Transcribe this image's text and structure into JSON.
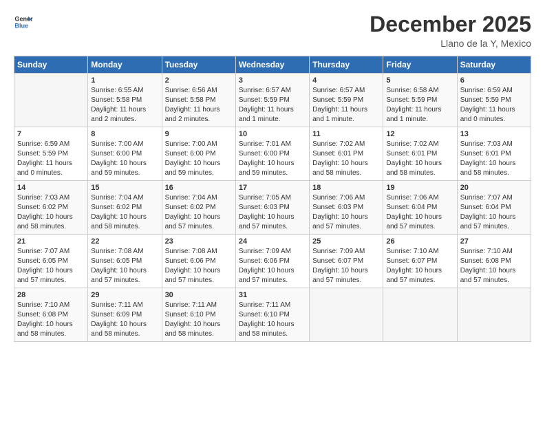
{
  "logo": {
    "line1": "General",
    "line2": "Blue"
  },
  "title": "December 2025",
  "location": "Llano de la Y, Mexico",
  "days_header": [
    "Sunday",
    "Monday",
    "Tuesday",
    "Wednesday",
    "Thursday",
    "Friday",
    "Saturday"
  ],
  "weeks": [
    [
      {
        "num": "",
        "info": ""
      },
      {
        "num": "1",
        "info": "Sunrise: 6:55 AM\nSunset: 5:58 PM\nDaylight: 11 hours\nand 2 minutes."
      },
      {
        "num": "2",
        "info": "Sunrise: 6:56 AM\nSunset: 5:58 PM\nDaylight: 11 hours\nand 2 minutes."
      },
      {
        "num": "3",
        "info": "Sunrise: 6:57 AM\nSunset: 5:59 PM\nDaylight: 11 hours\nand 1 minute."
      },
      {
        "num": "4",
        "info": "Sunrise: 6:57 AM\nSunset: 5:59 PM\nDaylight: 11 hours\nand 1 minute."
      },
      {
        "num": "5",
        "info": "Sunrise: 6:58 AM\nSunset: 5:59 PM\nDaylight: 11 hours\nand 1 minute."
      },
      {
        "num": "6",
        "info": "Sunrise: 6:59 AM\nSunset: 5:59 PM\nDaylight: 11 hours\nand 0 minutes."
      }
    ],
    [
      {
        "num": "7",
        "info": "Sunrise: 6:59 AM\nSunset: 5:59 PM\nDaylight: 11 hours\nand 0 minutes."
      },
      {
        "num": "8",
        "info": "Sunrise: 7:00 AM\nSunset: 6:00 PM\nDaylight: 10 hours\nand 59 minutes."
      },
      {
        "num": "9",
        "info": "Sunrise: 7:00 AM\nSunset: 6:00 PM\nDaylight: 10 hours\nand 59 minutes."
      },
      {
        "num": "10",
        "info": "Sunrise: 7:01 AM\nSunset: 6:00 PM\nDaylight: 10 hours\nand 59 minutes."
      },
      {
        "num": "11",
        "info": "Sunrise: 7:02 AM\nSunset: 6:01 PM\nDaylight: 10 hours\nand 58 minutes."
      },
      {
        "num": "12",
        "info": "Sunrise: 7:02 AM\nSunset: 6:01 PM\nDaylight: 10 hours\nand 58 minutes."
      },
      {
        "num": "13",
        "info": "Sunrise: 7:03 AM\nSunset: 6:01 PM\nDaylight: 10 hours\nand 58 minutes."
      }
    ],
    [
      {
        "num": "14",
        "info": "Sunrise: 7:03 AM\nSunset: 6:02 PM\nDaylight: 10 hours\nand 58 minutes."
      },
      {
        "num": "15",
        "info": "Sunrise: 7:04 AM\nSunset: 6:02 PM\nDaylight: 10 hours\nand 58 minutes."
      },
      {
        "num": "16",
        "info": "Sunrise: 7:04 AM\nSunset: 6:02 PM\nDaylight: 10 hours\nand 57 minutes."
      },
      {
        "num": "17",
        "info": "Sunrise: 7:05 AM\nSunset: 6:03 PM\nDaylight: 10 hours\nand 57 minutes."
      },
      {
        "num": "18",
        "info": "Sunrise: 7:06 AM\nSunset: 6:03 PM\nDaylight: 10 hours\nand 57 minutes."
      },
      {
        "num": "19",
        "info": "Sunrise: 7:06 AM\nSunset: 6:04 PM\nDaylight: 10 hours\nand 57 minutes."
      },
      {
        "num": "20",
        "info": "Sunrise: 7:07 AM\nSunset: 6:04 PM\nDaylight: 10 hours\nand 57 minutes."
      }
    ],
    [
      {
        "num": "21",
        "info": "Sunrise: 7:07 AM\nSunset: 6:05 PM\nDaylight: 10 hours\nand 57 minutes."
      },
      {
        "num": "22",
        "info": "Sunrise: 7:08 AM\nSunset: 6:05 PM\nDaylight: 10 hours\nand 57 minutes."
      },
      {
        "num": "23",
        "info": "Sunrise: 7:08 AM\nSunset: 6:06 PM\nDaylight: 10 hours\nand 57 minutes."
      },
      {
        "num": "24",
        "info": "Sunrise: 7:09 AM\nSunset: 6:06 PM\nDaylight: 10 hours\nand 57 minutes."
      },
      {
        "num": "25",
        "info": "Sunrise: 7:09 AM\nSunset: 6:07 PM\nDaylight: 10 hours\nand 57 minutes."
      },
      {
        "num": "26",
        "info": "Sunrise: 7:10 AM\nSunset: 6:07 PM\nDaylight: 10 hours\nand 57 minutes."
      },
      {
        "num": "27",
        "info": "Sunrise: 7:10 AM\nSunset: 6:08 PM\nDaylight: 10 hours\nand 57 minutes."
      }
    ],
    [
      {
        "num": "28",
        "info": "Sunrise: 7:10 AM\nSunset: 6:08 PM\nDaylight: 10 hours\nand 58 minutes."
      },
      {
        "num": "29",
        "info": "Sunrise: 7:11 AM\nSunset: 6:09 PM\nDaylight: 10 hours\nand 58 minutes."
      },
      {
        "num": "30",
        "info": "Sunrise: 7:11 AM\nSunset: 6:10 PM\nDaylight: 10 hours\nand 58 minutes."
      },
      {
        "num": "31",
        "info": "Sunrise: 7:11 AM\nSunset: 6:10 PM\nDaylight: 10 hours\nand 58 minutes."
      },
      {
        "num": "",
        "info": ""
      },
      {
        "num": "",
        "info": ""
      },
      {
        "num": "",
        "info": ""
      }
    ]
  ]
}
